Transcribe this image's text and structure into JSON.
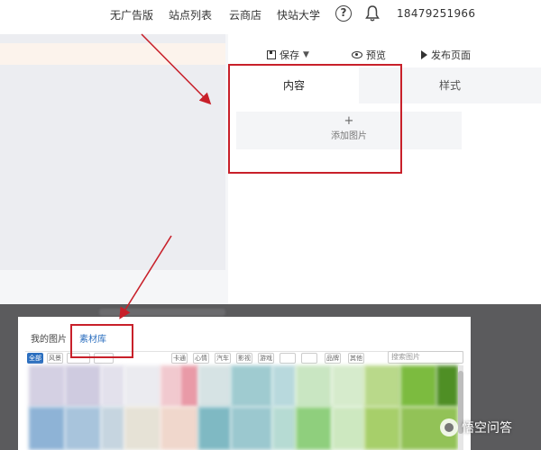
{
  "topnav": {
    "items": [
      "无广告版",
      "站点列表",
      "云商店",
      "快站大学"
    ],
    "help_icon": "question-circle-icon",
    "bell_icon": "bell-icon",
    "phone": "18479251966"
  },
  "toolbar": {
    "save_label": "保存",
    "preview_label": "预览",
    "publish_label": "发布页面"
  },
  "tabs": {
    "content": "内容",
    "style": "样式"
  },
  "add_image": {
    "plus": "+",
    "label": "添加图片"
  },
  "dialog": {
    "tabs": [
      "我的图片",
      "素材库"
    ],
    "active_tab": "素材库",
    "search_placeholder": "搜索图片",
    "chips": [
      "全部",
      "风景",
      "",
      "",
      "卡通",
      "心情",
      "汽车",
      "影视",
      "游戏",
      "",
      "",
      "品牌",
      "其他"
    ]
  },
  "watermark": {
    "text": "悟空问答"
  },
  "colors": {
    "annotation_red": "#c8202a",
    "accent_blue": "#2c6fbf",
    "dialog_overlay": "#5b5b5d"
  }
}
